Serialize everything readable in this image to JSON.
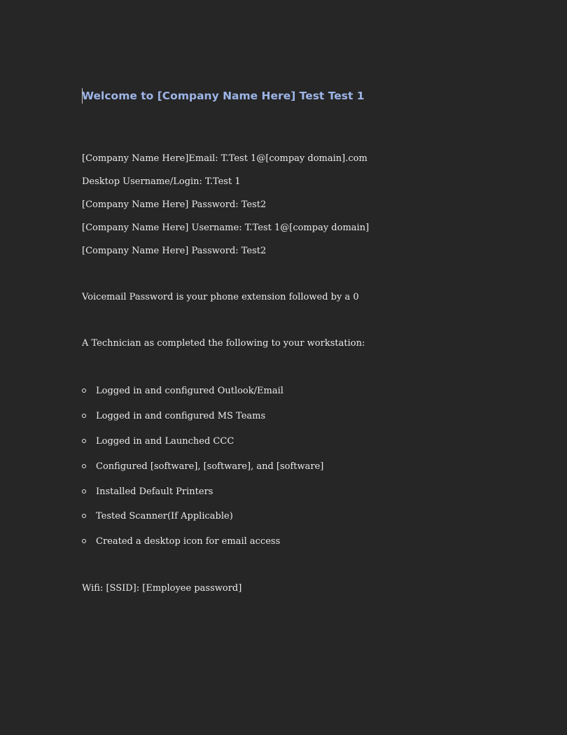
{
  "document": {
    "heading": "Welcome to [Company Name Here] Test Test 1",
    "credentials": [
      "[Company Name Here]Email: T.Test 1@[compay domain].com",
      "Desktop Username/Login: T.Test 1",
      "[Company Name Here] Password: Test2",
      "[Company Name Here] Username: T.Test 1@[compay domain]",
      "[Company Name Here] Password: Test2"
    ],
    "voicemail": "Voicemail Password is your phone extension followed by a 0",
    "technician_intro": "A Technician as completed the following to your workstation:",
    "checklist": [
      "Logged in and configured Outlook/Email",
      "Logged in and configured MS Teams",
      "Logged in and Launched CCC",
      "Configured [software], [software], and [software]",
      "Installed Default Printers",
      "Tested Scanner(If Applicable)",
      "Created a desktop icon for email access"
    ],
    "wifi": "Wifi: [SSID]: [Employee password]"
  },
  "colors": {
    "background": "#262626",
    "heading": "#9db4e6",
    "text": "#ececec"
  }
}
